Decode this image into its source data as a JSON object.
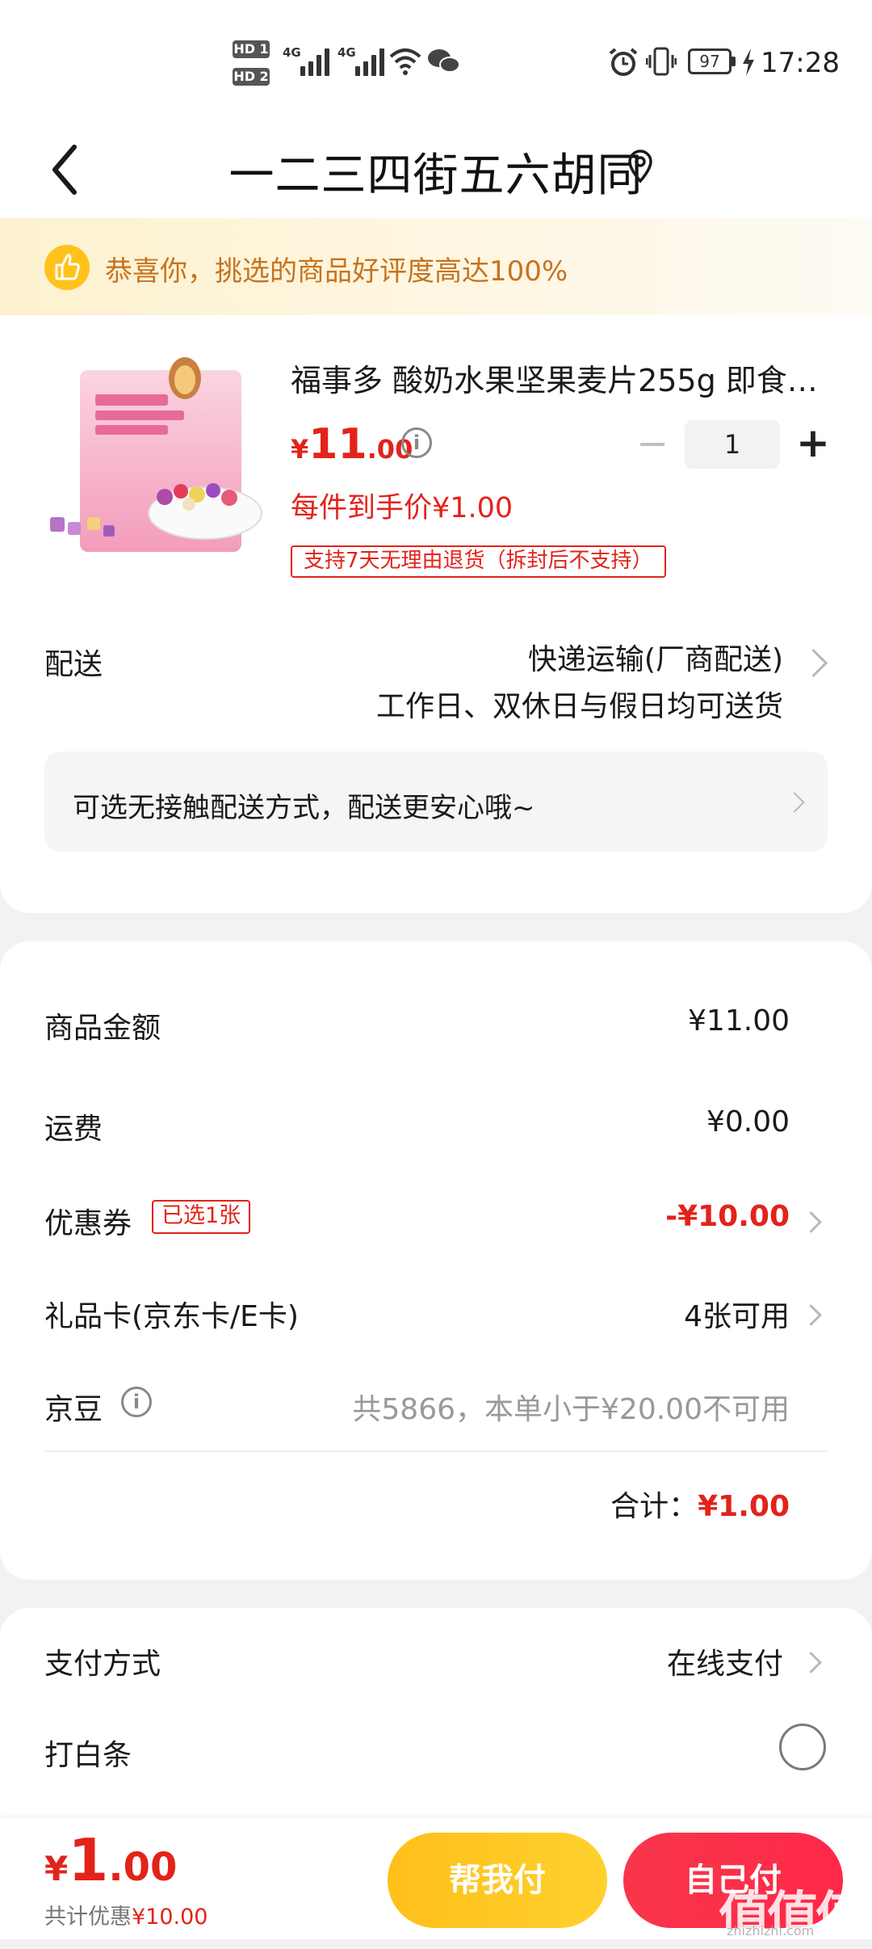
{
  "status_bar": {
    "hd1": "HD 1",
    "hd2": "HD 2",
    "net1": "4G",
    "net2": "4G",
    "battery": "97",
    "time": "17:28"
  },
  "header": {
    "title": "一二三四街五六胡同"
  },
  "notice": {
    "text": "恭喜你，挑选的商品好评度高达100%"
  },
  "product": {
    "name": "福事多 酸奶水果坚果麦片255g 即食…",
    "price_currency": "¥",
    "price_int": "11",
    "price_dec": ".00",
    "quantity": "1",
    "unit_price_text": "每件到手价¥1.00",
    "return_policy": "支持7天无理由退货（拆封后不支持）"
  },
  "delivery": {
    "label": "配送",
    "method": "快递运输(厂商配送)",
    "schedule": "工作日、双休日与假日均可送货",
    "contactless": "可选无接触配送方式，配送更安心哦~"
  },
  "summary": {
    "goods_label": "商品金额",
    "goods_value": "¥11.00",
    "shipping_label": "运费",
    "shipping_value": "¥0.00",
    "coupon_label": "优惠券",
    "coupon_tag": "已选1张",
    "coupon_value": "-¥10.00",
    "giftcard_label": "礼品卡(京东卡/E卡)",
    "giftcard_value": "4张可用",
    "beans_label": "京豆",
    "beans_value": "共5866，本单小于¥20.00不可用",
    "total_label": "合计：",
    "total_value": "¥1.00"
  },
  "payment": {
    "method_label": "支付方式",
    "method_value": "在线支付",
    "baitiao_label": "打白条"
  },
  "bottom": {
    "price_currency": "¥",
    "price_int": "1",
    "price_dec": ".00",
    "savings_label": "共计优惠",
    "savings_value": "¥10.00",
    "help_pay": "帮我付",
    "self_pay": "自己付",
    "watermark": "值值值",
    "watermark_url": "zhizhizhi.com"
  },
  "colors": {
    "accent_red": "#e2231a",
    "help_pay_yellow": "#ffc21a",
    "self_pay_red": "#f8364a",
    "notice_text": "#c7731f"
  },
  "icons": [
    "back-arrow-icon",
    "location-pin-icon",
    "thumbs-up-icon",
    "info-icon",
    "chevron-right-icon",
    "radio-unchecked-icon",
    "alarm-icon",
    "vibrate-icon",
    "battery-icon",
    "charging-icon",
    "wifi-icon",
    "wechat-icon",
    "signal-icon"
  ]
}
